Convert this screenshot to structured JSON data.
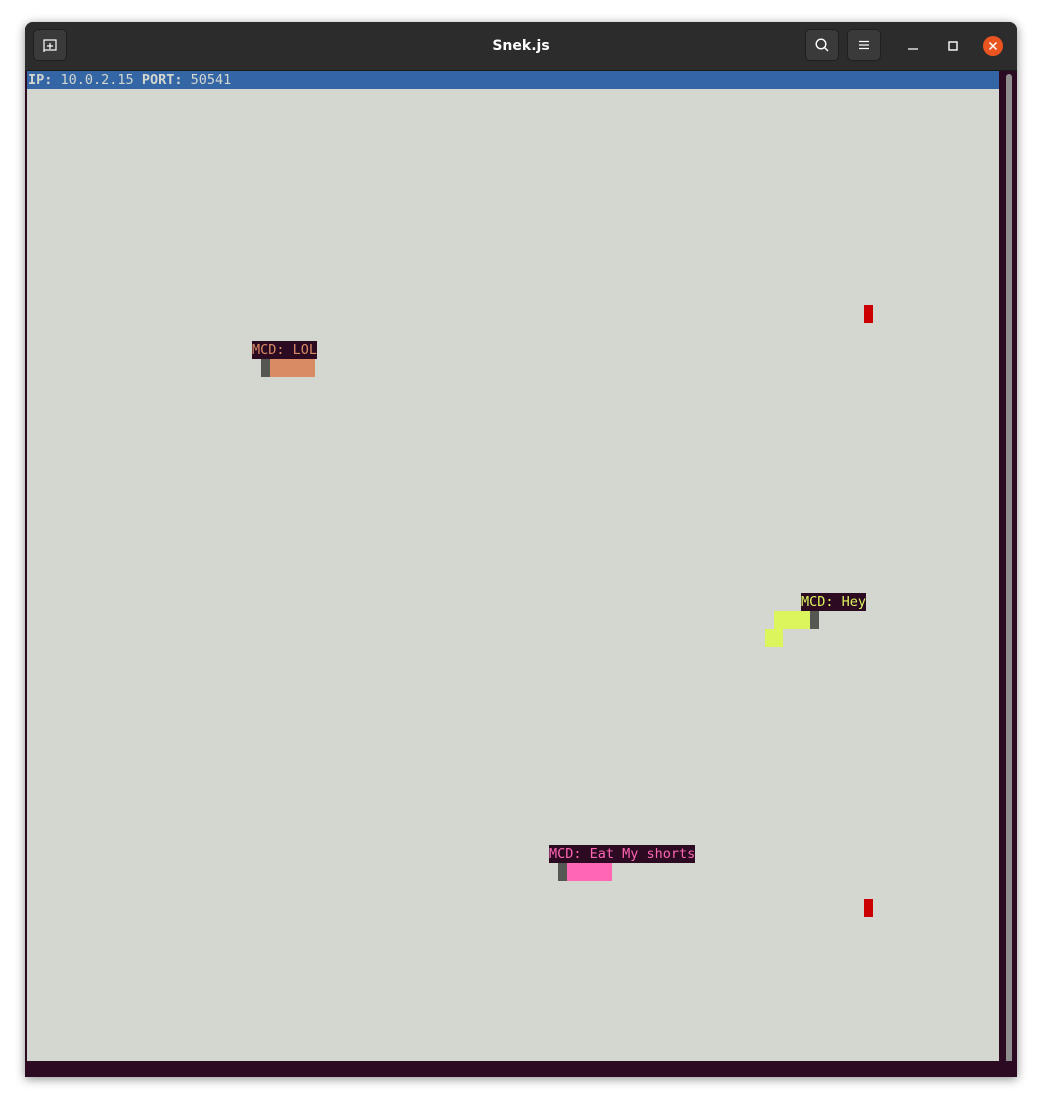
{
  "window": {
    "title": "Snek.js",
    "icons": {
      "new_tab": "new-tab-icon",
      "search": "search-icon",
      "menu": "hamburger-menu-icon",
      "minimize": "minimize-icon",
      "maximize": "maximize-icon",
      "close": "close-icon"
    }
  },
  "status": {
    "ip_label": "IP:",
    "ip_value": "10.0.2.15",
    "port_label": "PORT:",
    "port_value": "50541"
  },
  "snakes": [
    {
      "label": "MCD: LOL",
      "color": "#d98b64"
    },
    {
      "label": "MCD: Hey",
      "color": "#dcf55c"
    },
    {
      "label": "MCD: Eat My shorts",
      "color": "#ff66b3"
    }
  ],
  "colors": {
    "terminal_bg": "#d4d6d0",
    "status_bg": "#3465a4",
    "label_bg": "#2c0a22",
    "snake_head": "#555753",
    "food": "#cc0000",
    "close_button": "#e95420"
  }
}
